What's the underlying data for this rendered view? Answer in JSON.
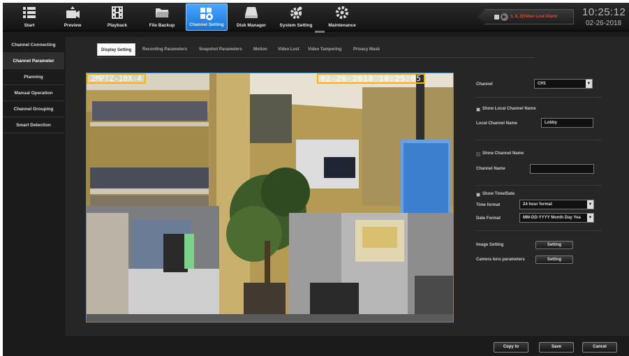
{
  "nav": {
    "items": [
      {
        "label": "Start",
        "icon": "menu-icon"
      },
      {
        "label": "Preview",
        "icon": "camera-icon"
      },
      {
        "label": "Playback",
        "icon": "film-icon"
      },
      {
        "label": "File Backup",
        "icon": "folder-icon"
      },
      {
        "label": "Channel Setting",
        "icon": "channel-settings-icon"
      },
      {
        "label": "Disk Manager",
        "icon": "disk-icon"
      },
      {
        "label": "System Setting",
        "icon": "system-gear-icon"
      },
      {
        "label": "Maintenance",
        "icon": "maintenance-gear-icon"
      }
    ],
    "active_index": 4
  },
  "alarm": {
    "text": "3, 4, 2|Video Lost Alarm",
    "color": "#e64a2e"
  },
  "clock": {
    "time": "10:25:12",
    "date": "02-26-2018"
  },
  "sidebar": {
    "items": [
      {
        "label": "Channel Connecting"
      },
      {
        "label": "Channel Parameter"
      },
      {
        "label": "Planning"
      },
      {
        "label": "Manual Operation"
      },
      {
        "label": "Channel Grouping"
      },
      {
        "label": "Smart Detection"
      }
    ],
    "active_index": 1
  },
  "tabs": [
    {
      "label": "Display Setting"
    },
    {
      "label": "Recording Parameters"
    },
    {
      "label": "Snapshot Parameters"
    },
    {
      "label": "Motion"
    },
    {
      "label": "Video Lost"
    },
    {
      "label": "Video Tampering"
    },
    {
      "label": "Privacy Mask"
    }
  ],
  "video": {
    "osd_name": "2MPTZ-10X-4",
    "osd_time": "02-26-2018 10:25:05"
  },
  "form": {
    "channel_label": "Channel",
    "channel_value": "CH1",
    "show_local_name_label": "Show Local Channel Name",
    "show_local_name_checked": true,
    "local_name_label": "Local Channel Name",
    "local_name_value": "Lobby",
    "show_channel_name_label": "Show Channel Name",
    "show_channel_name_checked": false,
    "channel_name_label": "Channel Name",
    "channel_name_value": "",
    "show_time_label": "Show Time/Date",
    "show_time_checked": true,
    "time_format_label": "Time format",
    "time_format_value": "24 hour format",
    "date_format_label": "Date Format",
    "date_format_value": "MM-DD-YYYY Month Day Yea",
    "image_setting_label": "Image Setting",
    "image_setting_button": "Setting",
    "lens_label": "Camera lens parameters",
    "lens_button": "Setting"
  },
  "footer": {
    "copy_to": "Copy to",
    "save": "Save",
    "cancel": "Cancel"
  },
  "colors": {
    "accent": "#1a72d8",
    "osd_border": "#ffb400",
    "video_border": "#4a8fc7"
  }
}
